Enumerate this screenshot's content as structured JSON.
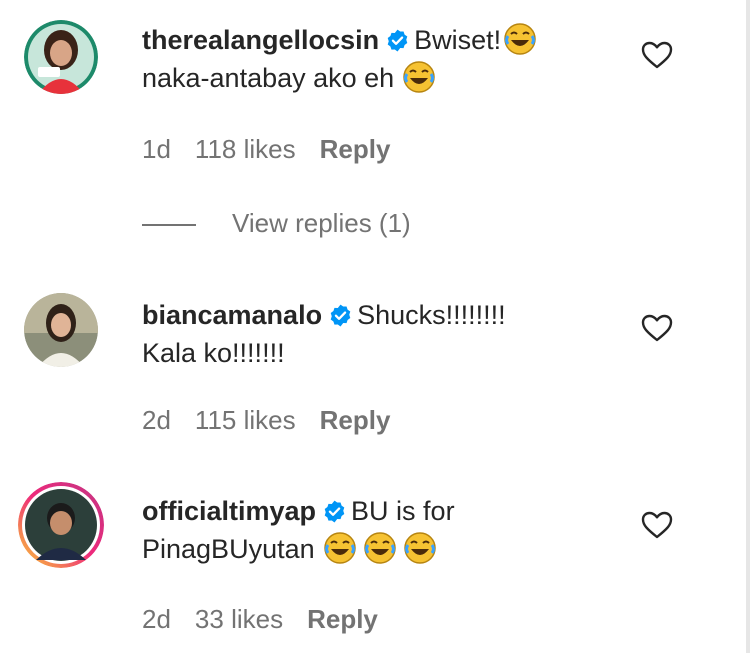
{
  "comments": [
    {
      "username": "therealangellocsin",
      "text_line1": "Bwiset!",
      "text_line2": "naka-antabay ako eh",
      "time": "1d",
      "likes": "118 likes",
      "reply": "Reply",
      "view_replies": "View replies (1)"
    },
    {
      "username": "biancamanalo",
      "text_line1": "Shucks!!!!!!!!",
      "text_line2": "Kala ko!!!!!!!",
      "time": "2d",
      "likes": "115 likes",
      "reply": "Reply"
    },
    {
      "username": "officialtimyap",
      "text_line1": "BU is for",
      "text_line2": "PinagBUyutan",
      "time": "2d",
      "likes": "33 likes",
      "reply": "Reply"
    }
  ],
  "icons": {
    "verified": "verified-badge-icon",
    "emoji": "face-with-tears-of-joy-emoji",
    "like": "heart-outline-icon"
  },
  "colors": {
    "verified_blue": "#0095f6",
    "meta_gray": "#737373",
    "text": "#262626",
    "story_ring_start": "#f9ce34",
    "story_ring_end": "#c13584"
  }
}
